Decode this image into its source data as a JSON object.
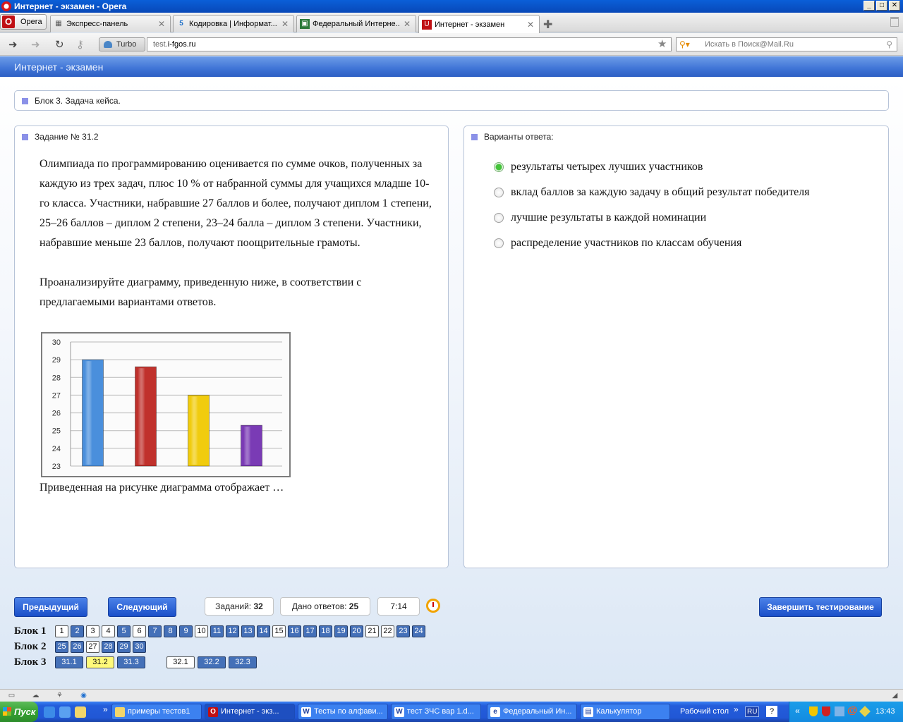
{
  "window": {
    "title": "Интернет - экзамен - Opera"
  },
  "browser": {
    "opera_label": "Opera",
    "tabs": [
      {
        "label": "Экспресс-панель"
      },
      {
        "label": "Кодировка | Информат..."
      },
      {
        "label": "Федеральный Интерне..."
      },
      {
        "label": "Интернет - экзамен"
      }
    ],
    "turbo_label": "Turbo",
    "url_prefix": "test.",
    "url_host": "i-fgos.ru",
    "search_placeholder": "Искать в Поиск@Mail.Ru"
  },
  "page": {
    "header_title": "Интернет - экзамен",
    "block_title": "Блок 3. Задача кейса.",
    "task_title": "Задание № 31.2",
    "task_paragraph_1": "Олимпиада по программированию оценивается по сумме очков, полученных за каждую из трех задач, плюс 10 % от набранной суммы для учащихся младше 10-го класса. Участники, набравшие 27 баллов и более, получают диплом 1 степени, 25–26 баллов – диплом 2 степени, 23–24 балла – диплом 3 степени. Участники, набравшие меньше 23 баллов, получают поощрительные грамоты.",
    "task_paragraph_2": "Проанализируйте диаграмму, приведенную ниже, в соответствии с предлагаемыми вариантами ответов.",
    "question": "Приведенная на рисунке диаграмма отображает …",
    "answers_title": "Варианты ответа:",
    "options": [
      {
        "label": "результаты четырех лучших участников",
        "selected": true
      },
      {
        "label": "вклад баллов за каждую задачу в общий результат победителя",
        "selected": false
      },
      {
        "label": "лучшие результаты в каждой номинации",
        "selected": false
      },
      {
        "label": "распределение участников по классам обучения",
        "selected": false
      }
    ]
  },
  "chart_data": {
    "type": "bar",
    "categories": [
      "",
      "",
      "",
      ""
    ],
    "values": [
      29,
      28.6,
      27,
      25.3
    ],
    "colors": [
      "#4a8fdc",
      "#c0312c",
      "#f1cc0e",
      "#7a3bb5"
    ],
    "yticks": [
      "23",
      "24",
      "25",
      "26",
      "27",
      "28",
      "29",
      "30"
    ],
    "ylim": [
      23,
      30
    ],
    "grid": true,
    "legend": "none"
  },
  "controls": {
    "prev_label": "Предыдущий",
    "next_label": "Следующий",
    "tasks_label": "Заданий:",
    "tasks_count": "32",
    "answered_label": "Дано ответов:",
    "answered_count": "25",
    "timer": "7:14",
    "finish_label": "Завершить тестирование"
  },
  "navigation": {
    "block1_label": "Блок 1",
    "block2_label": "Блок 2",
    "block3_label": "Блок 3",
    "block1": [
      {
        "n": "1",
        "s": "todo"
      },
      {
        "n": "2",
        "s": "done"
      },
      {
        "n": "3",
        "s": "todo"
      },
      {
        "n": "4",
        "s": "todo"
      },
      {
        "n": "5",
        "s": "done"
      },
      {
        "n": "6",
        "s": "todo"
      },
      {
        "n": "7",
        "s": "done"
      },
      {
        "n": "8",
        "s": "done"
      },
      {
        "n": "9",
        "s": "done"
      },
      {
        "n": "10",
        "s": "todo"
      },
      {
        "n": "11",
        "s": "done"
      },
      {
        "n": "12",
        "s": "done"
      },
      {
        "n": "13",
        "s": "done"
      },
      {
        "n": "14",
        "s": "done"
      },
      {
        "n": "15",
        "s": "todo"
      },
      {
        "n": "16",
        "s": "done"
      },
      {
        "n": "17",
        "s": "done"
      },
      {
        "n": "18",
        "s": "done"
      },
      {
        "n": "19",
        "s": "done"
      },
      {
        "n": "20",
        "s": "done"
      },
      {
        "n": "21",
        "s": "todo"
      },
      {
        "n": "22",
        "s": "todo"
      },
      {
        "n": "23",
        "s": "done"
      },
      {
        "n": "24",
        "s": "done"
      }
    ],
    "block2": [
      {
        "n": "25",
        "s": "done"
      },
      {
        "n": "26",
        "s": "done"
      },
      {
        "n": "27",
        "s": "todo"
      },
      {
        "n": "28",
        "s": "done"
      },
      {
        "n": "29",
        "s": "done"
      },
      {
        "n": "30",
        "s": "done"
      }
    ],
    "block3": [
      {
        "n": "31.1",
        "s": "done"
      },
      {
        "n": "31.2",
        "s": "cur"
      },
      {
        "n": "31.3",
        "s": "done"
      },
      {
        "n": "32.1",
        "s": "todo"
      },
      {
        "n": "32.2",
        "s": "done"
      },
      {
        "n": "32.3",
        "s": "done"
      }
    ]
  },
  "taskbar": {
    "start_label": "Пуск",
    "items": [
      {
        "label": "примеры тестов1"
      },
      {
        "label": "Интернет - экз..."
      },
      {
        "label": "Тесты по алфави..."
      },
      {
        "label": "тест ЗЧС вар 1.d..."
      },
      {
        "label": "Федеральный Ин..."
      },
      {
        "label": "Калькулятор"
      }
    ],
    "desktop_label": "Рабочий стол",
    "lang": "RU",
    "time": "13:43"
  }
}
